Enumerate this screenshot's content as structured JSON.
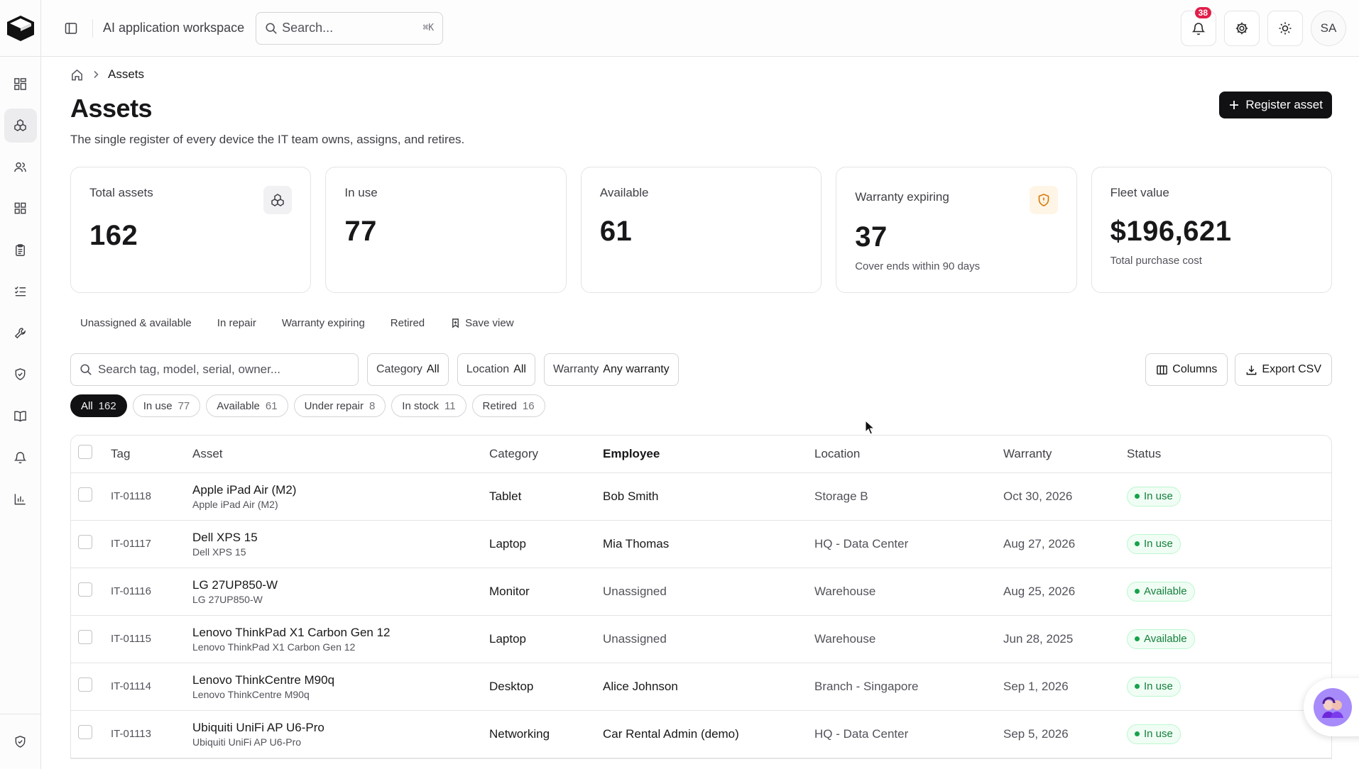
{
  "topbar": {
    "workspace_title": "AI application workspace",
    "search_placeholder": "Search...",
    "search_shortcut": "⌘K",
    "notifications_count": "38",
    "avatar_initials": "SA"
  },
  "rail": {
    "items": [
      "dashboard-icon",
      "assets-icon",
      "people-icon",
      "apps-icon",
      "clipboard-icon",
      "checklist-icon",
      "wrench-icon",
      "shield-icon",
      "book-icon",
      "bell-icon",
      "chart-icon"
    ],
    "active": "assets-icon"
  },
  "breadcrumb": {
    "current": "Assets"
  },
  "page": {
    "title": "Assets",
    "subtitle": "The single register of every device the IT team owns, assigns, and retires.",
    "register_button": "Register asset"
  },
  "cards": [
    {
      "label": "Total assets",
      "value": "162",
      "sub": ""
    },
    {
      "label": "In use",
      "value": "77",
      "sub": ""
    },
    {
      "label": "Available",
      "value": "61",
      "sub": ""
    },
    {
      "label": "Warranty expiring",
      "value": "37",
      "sub": "Cover ends within 90 days"
    },
    {
      "label": "Fleet value",
      "value": "$196,621",
      "sub": "Total purchase cost"
    }
  ],
  "saved_views": [
    "Unassigned & available",
    "In repair",
    "Warranty expiring",
    "Retired"
  ],
  "save_view_label": "Save view",
  "filters": {
    "search_placeholder": "Search tag, model, serial, owner...",
    "category_label": "Category",
    "category_value": "All",
    "location_label": "Location",
    "location_value": "All",
    "warranty_label": "Warranty",
    "warranty_value": "Any warranty",
    "columns_button": "Columns",
    "export_button": "Export CSV"
  },
  "pills": [
    {
      "label": "All",
      "count": "162"
    },
    {
      "label": "In use",
      "count": "77"
    },
    {
      "label": "Available",
      "count": "61"
    },
    {
      "label": "Under repair",
      "count": "8"
    },
    {
      "label": "In stock",
      "count": "11"
    },
    {
      "label": "Retired",
      "count": "16"
    }
  ],
  "table": {
    "headers": [
      "Tag",
      "Asset",
      "Category",
      "Employee",
      "Location",
      "Warranty",
      "Status"
    ],
    "rows": [
      {
        "tag": "IT-01118",
        "asset": "Apple iPad Air (M2)",
        "asset_sub": "Apple iPad Air (M2)",
        "category": "Tablet",
        "employee": "Bob Smith",
        "location": "Storage B",
        "warranty": "Oct 30, 2026",
        "status": "In use"
      },
      {
        "tag": "IT-01117",
        "asset": "Dell XPS 15",
        "asset_sub": "Dell XPS 15",
        "category": "Laptop",
        "employee": "Mia Thomas",
        "location": "HQ - Data Center",
        "warranty": "Aug 27, 2026",
        "status": "In use"
      },
      {
        "tag": "IT-01116",
        "asset": "LG 27UP850-W",
        "asset_sub": "LG 27UP850-W",
        "category": "Monitor",
        "employee": "Unassigned",
        "location": "Warehouse",
        "warranty": "Aug 25, 2026",
        "status": "Available"
      },
      {
        "tag": "IT-01115",
        "asset": "Lenovo ThinkPad X1 Carbon Gen 12",
        "asset_sub": "Lenovo ThinkPad X1 Carbon Gen 12",
        "category": "Laptop",
        "employee": "Unassigned",
        "location": "Warehouse",
        "warranty": "Jun 28, 2025",
        "status": "Available"
      },
      {
        "tag": "IT-01114",
        "asset": "Lenovo ThinkCentre M90q",
        "asset_sub": "Lenovo ThinkCentre M90q",
        "category": "Desktop",
        "employee": "Alice Johnson",
        "location": "Branch - Singapore",
        "warranty": "Sep 1, 2026",
        "status": "In use"
      },
      {
        "tag": "IT-01113",
        "asset": "Ubiquiti UniFi AP U6-Pro",
        "asset_sub": "Ubiquiti UniFi AP U6-Pro",
        "category": "Networking",
        "employee": "Car Rental Admin (demo)",
        "location": "HQ - Data Center",
        "warranty": "Sep 5, 2026",
        "status": "In use"
      }
    ]
  },
  "colors": {
    "accent": "#111113",
    "status_green": "#15803d",
    "warn": "#d97706",
    "badge": "#e11d48"
  }
}
